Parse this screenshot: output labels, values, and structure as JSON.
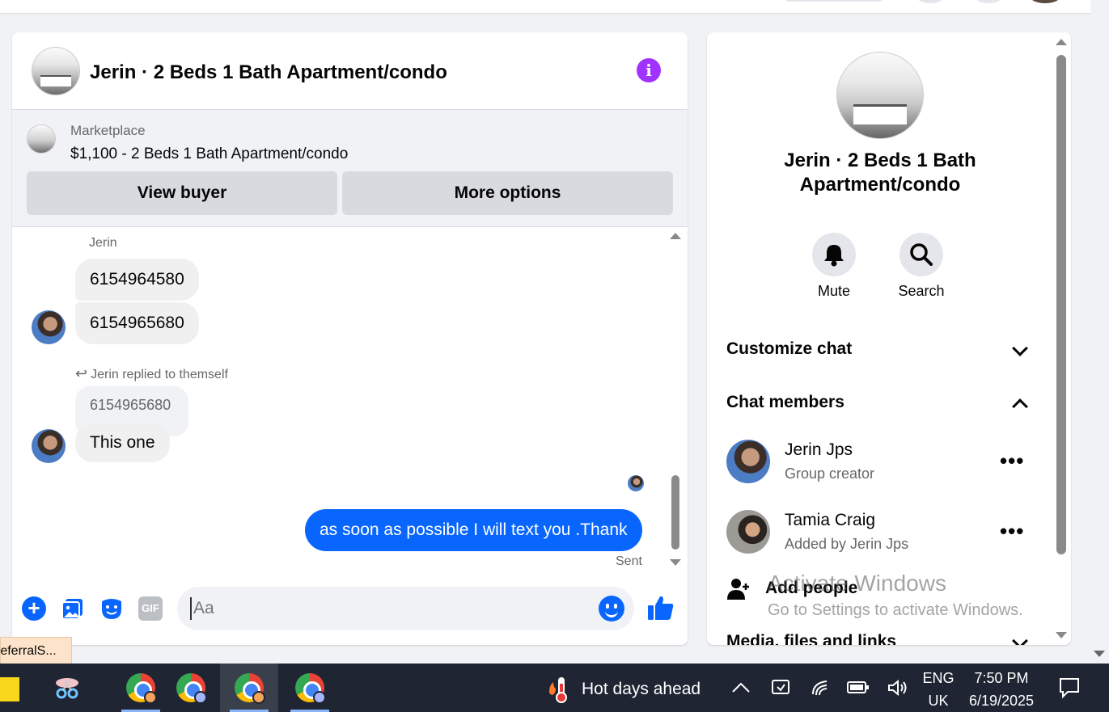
{
  "chat": {
    "title": "Jerin · 2 Beds 1 Bath Apartment/condo",
    "marketplace_label": "Marketplace",
    "listing_price": "$1,100 - 2 Beds 1 Bath Apartment/condo",
    "view_buyer": "View buyer",
    "more_options": "More options",
    "sender_name": "Jerin",
    "messages": [
      {
        "text": "6154964580"
      },
      {
        "text": "6154965680"
      }
    ],
    "reply_note": "Jerin replied to themself",
    "quoted_text": "6154965680",
    "reply_text": "This one",
    "my_message": "as soon as possible I will text you .Thank",
    "status": "Sent",
    "input_placeholder": "Aa",
    "gif_label": "GIF",
    "colors": {
      "accent": "#0866ff",
      "info": "#a033ff"
    }
  },
  "side": {
    "title": "Jerin · 2 Beds 1 Bath Apartment/condo",
    "mute_label": "Mute",
    "search_label": "Search",
    "customize_chat": "Customize chat",
    "chat_members": "Chat members",
    "members": [
      {
        "name": "Jerin Jps",
        "role": "Group creator"
      },
      {
        "name": "Tamia Craig",
        "role": "Added by Jerin Jps"
      }
    ],
    "add_people": "Add people",
    "media_files_links": "Media, files and links"
  },
  "watermark": {
    "line1": "Activate Windows",
    "line2": "Go to Settings to activate Windows."
  },
  "tooltip_chip": "referralS...",
  "taskbar": {
    "weather": "Hot days ahead",
    "lang_line1": "ENG",
    "lang_line2": "UK",
    "time": "7:50 PM",
    "date": "6/19/2025",
    "icons": [
      "sticky-notes-icon",
      "snipping-tool-icon",
      "chrome-icon",
      "chrome-icon",
      "chrome-icon",
      "chrome-icon",
      "thermometer-icon",
      "chevron-up-icon",
      "meet-now-icon",
      "wifi-icon",
      "battery-icon",
      "volume-icon",
      "notification-icon"
    ]
  }
}
